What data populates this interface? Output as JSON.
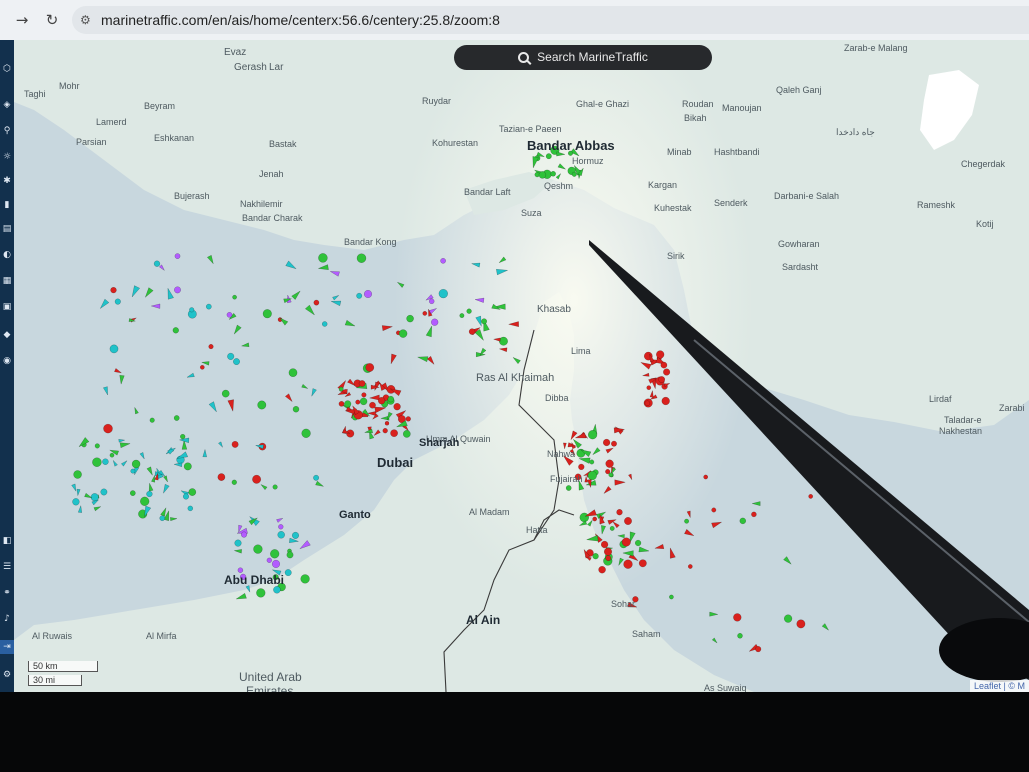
{
  "browser": {
    "back_icon": "arrow-right-icon",
    "reload_icon": "reload-icon",
    "url": "marinetraffic.com/en/ais/home/centerx:56.6/centery:25.8/zoom:8"
  },
  "search": {
    "label": "Search MarineTraffic",
    "icon": "search-icon"
  },
  "scale": {
    "km": "50 km",
    "mi": "30 mi"
  },
  "attribution": "Leaflet | © M",
  "colors": {
    "sea": "#c8d7de",
    "land": "#dce9e3",
    "land_highlight": "#f4f8ef",
    "tanker": "#d9211d",
    "cargo": "#2fc23a",
    "passenger": "#20c2c9",
    "pleasure": "#b35cff",
    "sidebar": "#12304d"
  },
  "places": [
    {
      "name": "Evaz"
    },
    {
      "name": "Gerash"
    },
    {
      "name": "Lar"
    },
    {
      "name": "Mohr"
    },
    {
      "name": "Taghi"
    },
    {
      "name": "Beyram"
    },
    {
      "name": "Lamerd"
    },
    {
      "name": "Parsian"
    },
    {
      "name": "Eshkanan"
    },
    {
      "name": "Bastak"
    },
    {
      "name": "Ruydar"
    },
    {
      "name": "Tazian-e Paeen"
    },
    {
      "name": "Kohurestan"
    },
    {
      "name": "Bandar Abbas"
    },
    {
      "name": "Ghal-e Ghazi"
    },
    {
      "name": "Roudan"
    },
    {
      "name": "Bikah"
    },
    {
      "name": "Manoujan"
    },
    {
      "name": "Qaleh Ganj"
    },
    {
      "name": "Zarab-e Malang"
    },
    {
      "name": "جاه دادخدا"
    },
    {
      "name": "Minab"
    },
    {
      "name": "Hashtbandi"
    },
    {
      "name": "Chegerdak"
    },
    {
      "name": "Hormuz"
    },
    {
      "name": "Qeshm"
    },
    {
      "name": "Jenah"
    },
    {
      "name": "Bujerash"
    },
    {
      "name": "Nakhilemir"
    },
    {
      "name": "Bandar Charak"
    },
    {
      "name": "Bandar Laft"
    },
    {
      "name": "Suza"
    },
    {
      "name": "Kargan"
    },
    {
      "name": "Kuhestak"
    },
    {
      "name": "Senderk"
    },
    {
      "name": "Darbani-e Salah"
    },
    {
      "name": "Rameshk"
    },
    {
      "name": "Kotij"
    },
    {
      "name": "Bandar Kong"
    },
    {
      "name": "Sirik"
    },
    {
      "name": "Gowharan"
    },
    {
      "name": "Sardasht"
    },
    {
      "name": "Khasab"
    },
    {
      "name": "Lima"
    },
    {
      "name": "Ras Al Khaimah"
    },
    {
      "name": "Dibba"
    },
    {
      "name": "Umm Al Quwain"
    },
    {
      "name": "Sharjah"
    },
    {
      "name": "Dubai"
    },
    {
      "name": "Nahwa"
    },
    {
      "name": "Fujairah"
    },
    {
      "name": "Ganto"
    },
    {
      "name": "Al Madam"
    },
    {
      "name": "Hatta"
    },
    {
      "name": "Abu Dhabi"
    },
    {
      "name": "Al Ain"
    },
    {
      "name": "Sohar"
    },
    {
      "name": "Saham"
    },
    {
      "name": "Al Mirfa"
    },
    {
      "name": "Al Ruwais"
    },
    {
      "name": "United Arab"
    },
    {
      "name": "Emirates"
    },
    {
      "name": "As Suwaiq"
    },
    {
      "name": "Lirdaf"
    },
    {
      "name": "Taladar-e"
    },
    {
      "name": "Nakhestan"
    },
    {
      "name": "Zarabi"
    }
  ]
}
